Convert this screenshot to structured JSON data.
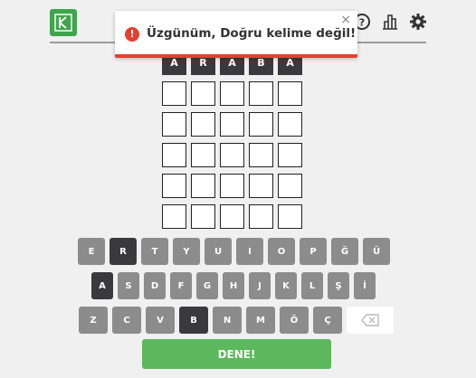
{
  "toast": {
    "message": "Üzgünüm, Doğru kelime değil!",
    "icon": "!",
    "close": "×"
  },
  "header": {
    "icons": [
      "help-icon",
      "stats-icon",
      "settings-icon"
    ]
  },
  "board": {
    "rows": [
      [
        "A",
        "R",
        "A",
        "B",
        "A"
      ],
      [
        "",
        "",
        "",
        "",
        ""
      ],
      [
        "",
        "",
        "",
        "",
        ""
      ],
      [
        "",
        "",
        "",
        "",
        ""
      ],
      [
        "",
        "",
        "",
        "",
        ""
      ],
      [
        "",
        "",
        "",
        "",
        ""
      ]
    ]
  },
  "keyboard": {
    "row1": [
      "E",
      "R",
      "T",
      "Y",
      "U",
      "I",
      "O",
      "P",
      "Ğ",
      "Ü"
    ],
    "row2": [
      "A",
      "S",
      "D",
      "F",
      "G",
      "H",
      "J",
      "K",
      "L",
      "Ş",
      "İ"
    ],
    "row3": [
      "Z",
      "C",
      "V",
      "B",
      "N",
      "M",
      "Ö",
      "Ç"
    ],
    "absent_keys": [
      "R",
      "A",
      "B"
    ],
    "enter_label": "DENE!"
  },
  "colors": {
    "absent": "#3a3a3c",
    "default_key": "#8c8c8c",
    "enter": "#5cb85c",
    "error": "#e4402f",
    "logo": "#3ea54b"
  }
}
